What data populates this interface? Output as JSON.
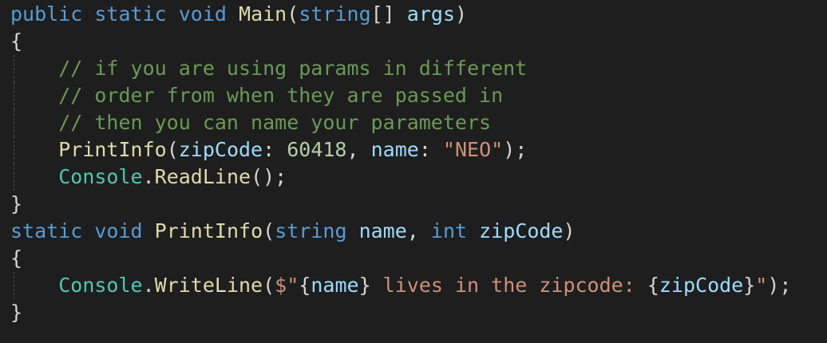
{
  "code": {
    "l1": {
      "kw_public": "public",
      "kw_static": "static",
      "kw_void": "void",
      "fn_main": "Main",
      "p_open": "(",
      "kw_string": "string",
      "p_brackets": "[]",
      "var_args": "args",
      "p_close": ")"
    },
    "l2": {
      "brace": "{"
    },
    "l3": {
      "comment": "// if you are using params in different"
    },
    "l4": {
      "comment": "// order from when they are passed in"
    },
    "l5": {
      "comment": "// then you can name your parameters"
    },
    "l6": {
      "fn_printinfo": "PrintInfo",
      "p_open": "(",
      "arg_zip": "zipCode",
      "colon1": ": ",
      "num_zip": "60418",
      "comma": ", ",
      "arg_name": "name",
      "colon2": ": ",
      "str_neo": "\"NEO\"",
      "p_close": ");"
    },
    "l7": {
      "ty_console": "Console",
      "dot": ".",
      "fn_readline": "ReadLine",
      "p_call": "();"
    },
    "l8": {
      "brace": "}"
    },
    "l9": {
      "kw_static": "static",
      "kw_void": "void",
      "fn_printinfo": "PrintInfo",
      "p_open": "(",
      "kw_string": "string",
      "var_name": "name",
      "comma": ", ",
      "kw_int": "int",
      "var_zip": "zipCode",
      "p_close": ")"
    },
    "l10": {
      "brace": "{"
    },
    "l11": {
      "ty_console": "Console",
      "dot": ".",
      "fn_writeline": "WriteLine",
      "p_open": "(",
      "str_prefix": "$\"",
      "interp_open1": "{",
      "var_name": "name",
      "interp_close1": "}",
      "str_mid": " lives in the zipcode: ",
      "interp_open2": "{",
      "var_zip": "zipCode",
      "interp_close2": "}",
      "str_end": "\"",
      "p_close": ");"
    },
    "l12": {
      "brace": "}"
    }
  },
  "colors": {
    "background": "#1e1e1e",
    "keyword": "#569cd6",
    "function": "#dcdcaa",
    "type": "#4ec9b0",
    "variable": "#9cdcfe",
    "number": "#b5cea8",
    "string": "#ce9178",
    "comment": "#6a9955",
    "punctuation": "#d4d4d4"
  }
}
